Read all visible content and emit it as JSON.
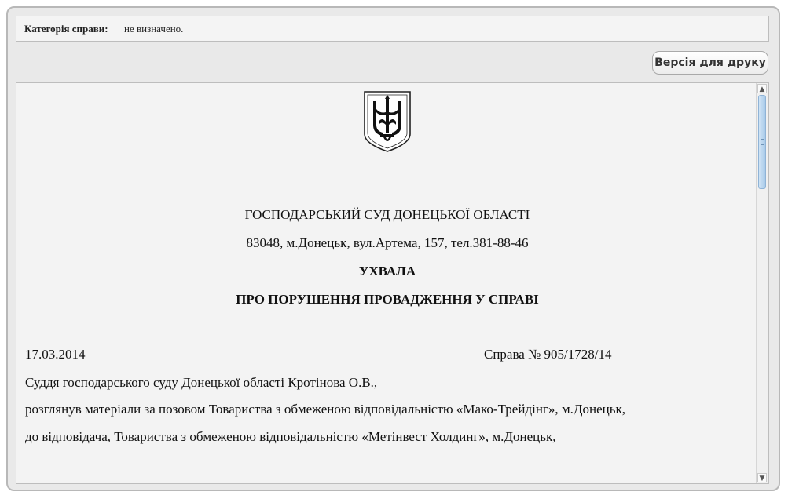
{
  "category": {
    "label": "Категорія справи:",
    "value": "не визначено."
  },
  "toolbar": {
    "print_label": "Версія для друку"
  },
  "document": {
    "emblem_icon": "trident-coat-of-arms-icon",
    "court_name": "ГОСПОДАРСЬКИЙ СУД ДОНЕЦЬКОЇ ОБЛАСТІ",
    "court_address": "83048, м.Донецьк, вул.Артема, 157, тел.381-88-46",
    "doc_type": "УХВАЛА",
    "doc_subject": "ПРО ПОРУШЕННЯ ПРОВАДЖЕННЯ У СПРАВІ",
    "date": "17.03.2014",
    "case_number": "Справа № 905/1728/14",
    "paragraphs": [
      "Суддя господарського суду Донецької області Кротінова О.В.,",
      "розглянув матеріали за позовом Товариства з обмеженою відповідальністю «Мако-Трейдінг», м.Донецьк,",
      "до відповідача, Товариства з обмеженою відповідальністю «Метінвест Холдинг», м.Донецьк,"
    ]
  },
  "colors": {
    "frame_bg": "#e9e9e9",
    "doc_bg": "#f3f3f3",
    "scroll_thumb": "#a9cbe9"
  }
}
